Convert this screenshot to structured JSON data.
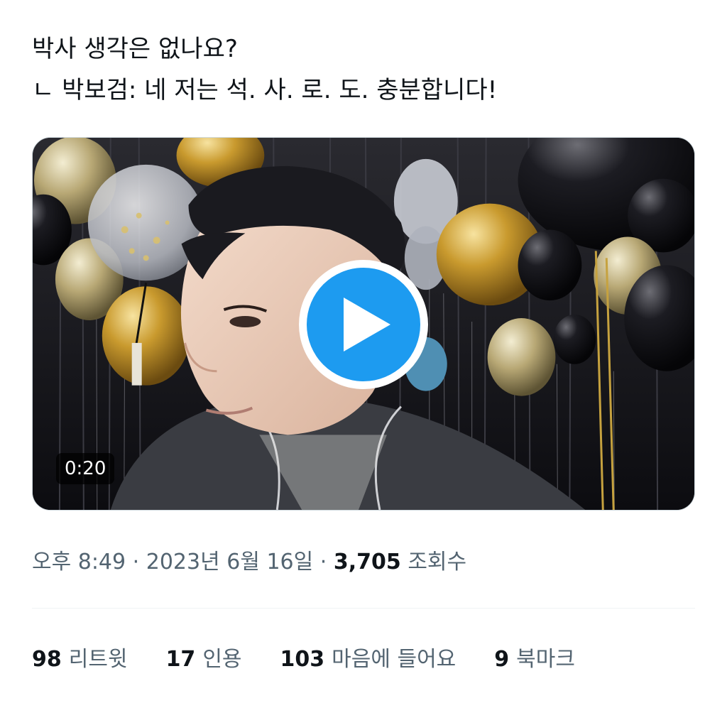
{
  "tweet": {
    "lines": [
      "박사 생각은 없나요?",
      "ㄴ 박보검: 네 저는 석. 사. 로. 도. 충분합니다!"
    ]
  },
  "media": {
    "duration": "0:20",
    "play_icon": "play-icon",
    "accent_color": "#1d9bf0"
  },
  "meta": {
    "time": "오후 8:49",
    "separator": "·",
    "date": "2023년 6월 16일",
    "views_count": "3,705",
    "views_label": "조회수"
  },
  "stats": [
    {
      "count": "98",
      "label": "리트윗"
    },
    {
      "count": "17",
      "label": "인용"
    },
    {
      "count": "103",
      "label": "마음에 들어요"
    },
    {
      "count": "9",
      "label": "북마크"
    }
  ]
}
